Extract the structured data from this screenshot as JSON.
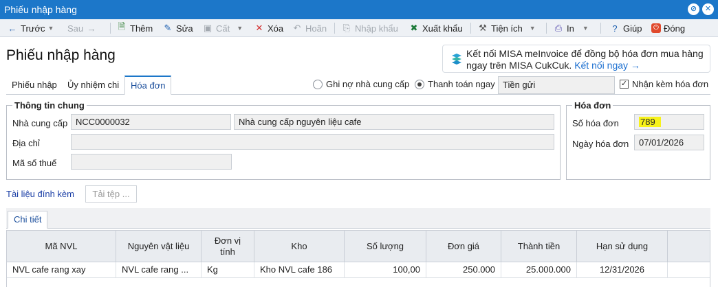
{
  "window": {
    "title": "Phiếu nhập hàng"
  },
  "toolbar": {
    "prev": "Trước",
    "next": "Sau",
    "add": "Thêm",
    "edit": "Sửa",
    "save": "Cất",
    "delete": "Xóa",
    "undo": "Hoãn",
    "import": "Nhập khẩu",
    "export": "Xuất khẩu",
    "utilities": "Tiện ích",
    "print": "In",
    "help": "Giúp",
    "close": "Đóng"
  },
  "page_title": "Phiếu nhập hàng",
  "banner": {
    "line1": "Kết nối MISA meInvoice để đồng bộ hóa đơn mua hàng",
    "line2": "ngay trên MISA CukCuk.",
    "link": "Kết nối ngay →"
  },
  "tabs": [
    "Phiếu nhập",
    "Ủy nhiệm chi",
    "Hóa đơn"
  ],
  "payment": {
    "option1": "Ghi nợ nhà cung cấp",
    "option2": "Thanh toán ngay",
    "method": "Tiền gửi",
    "receive_invoice": "Nhận kèm hóa đơn"
  },
  "general": {
    "title": "Thông tin chung",
    "supplier_label": "Nhà cung cấp",
    "supplier_code": "NCC0000032",
    "supplier_name": "Nhà cung cấp nguyên liệu cafe",
    "address_label": "Địa chỉ",
    "address": "",
    "tax_label": "Mã số thuế",
    "tax_code": ""
  },
  "invoice": {
    "title": "Hóa đơn",
    "number_label": "Số hóa đơn",
    "number": "789",
    "date_label": "Ngày hóa đơn",
    "date": "07/01/2026"
  },
  "attachments": {
    "label": "Tài liệu đính kèm",
    "upload": "Tải tệp ..."
  },
  "detail_tab": "Chi tiết",
  "table": {
    "headers": [
      "Mã NVL",
      "Nguyên vật liệu",
      "Đơn vị tính",
      "Kho",
      "Số lượng",
      "Đơn giá",
      "Thành tiền",
      "Hạn sử dụng"
    ],
    "rows": [
      [
        "NVL cafe rang xay",
        "NVL cafe rang ...",
        "Kg",
        "Kho NVL cafe 186",
        "100,00",
        "250.000",
        "25.000.000",
        "12/31/2026"
      ]
    ]
  },
  "colors": {
    "titlebar": "#1c77c9",
    "highlight": "#f7f21a",
    "link": "#1b6fd0"
  }
}
